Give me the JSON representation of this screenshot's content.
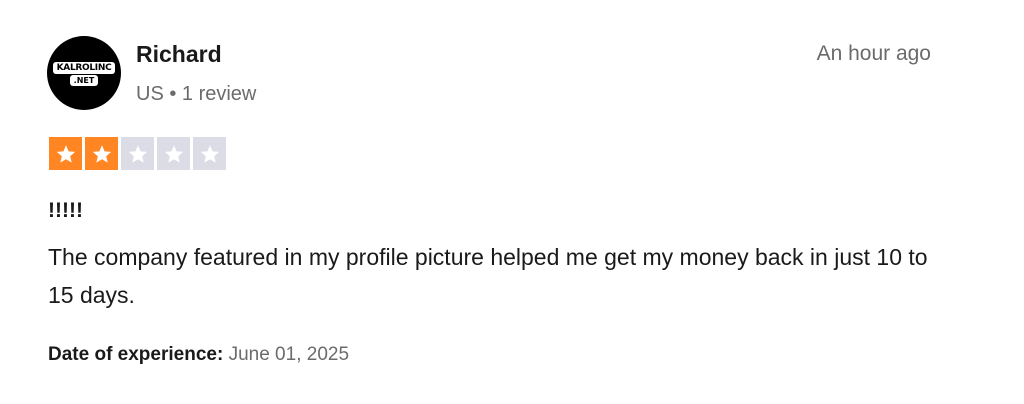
{
  "reviewer": {
    "avatar_text_line1": "KALROLINC",
    "avatar_text_line2": ".NET",
    "name": "Richard",
    "meta": "US • 1 review"
  },
  "review": {
    "timestamp": "An hour ago",
    "rating": 2,
    "rating_max": 5,
    "star_filled_color": "#ff8622",
    "star_empty_color": "#dcdce6",
    "title": "!!!!!",
    "body": "The company featured in my profile picture helped me get my money back in just 10 to 15 days.",
    "experience_label": "Date of experience:",
    "experience_date": "June 01, 2025"
  }
}
